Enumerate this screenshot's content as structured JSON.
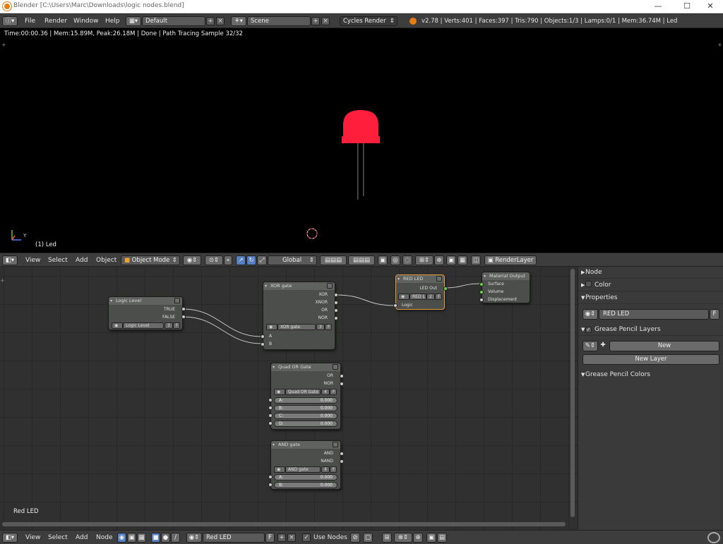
{
  "window": {
    "title": "Blender [C:\\Users\\Marc\\Downloads\\logic nodes.blend]",
    "minimize": "—",
    "maximize": "☐",
    "close": "✕"
  },
  "info_header": {
    "menus": [
      "File",
      "Render",
      "Window",
      "Help"
    ],
    "screen_layout": "Default",
    "scene": "Scene",
    "render_engine": "Cycles Render",
    "stats": "v2.78 | Verts:401 | Faces:397 | Tris:790 | Objects:1/3 | Lamps:0/1 | Mem:36.74M | Led"
  },
  "viewport": {
    "render_info": "Time:00:00.36 | Mem:15.89M, Peak:26.18M | Done | Path Tracing Sample 32/32",
    "object_label": "(1) Led",
    "axis_y": "Y"
  },
  "view3d_header": {
    "menus": [
      "View",
      "Select",
      "Add",
      "Object"
    ],
    "mode": "Object Mode",
    "orientation": "Global",
    "render_layer": "RenderLayer"
  },
  "node_editor": {
    "material_label": "Red LED",
    "nodes": {
      "logic_level": {
        "title": "Logic Level",
        "outputs": [
          "TRUE",
          "FALSE"
        ],
        "group": "Logic Level",
        "users": "3",
        "fake": "F"
      },
      "xor_gate": {
        "title": "XOR gate",
        "outputs": [
          "XOR",
          "XNOR",
          "OR",
          "NOR"
        ],
        "group": "XOR gate",
        "users": "3",
        "fake": "F",
        "inputs": [
          "A",
          "B"
        ]
      },
      "red_led": {
        "title": "RED LED",
        "output": "LED Out",
        "group": "RED L",
        "users": "2",
        "fake": "F",
        "input": "Logic"
      },
      "material_output": {
        "title": "Material Output",
        "inputs": [
          "Surface",
          "Volume",
          "Displacement"
        ]
      },
      "quad_or": {
        "title": "Quad OR Gate",
        "outputs": [
          "OR",
          "NOR"
        ],
        "group": "Quad OR Gate",
        "users": "4",
        "fake": "F",
        "inputs": [
          {
            "label": "A:",
            "value": "0.000"
          },
          {
            "label": "B:",
            "value": "0.000"
          },
          {
            "label": "C:",
            "value": "0.000"
          },
          {
            "label": "D:",
            "value": "0.000"
          }
        ]
      },
      "and_gate": {
        "title": "AND gate",
        "outputs": [
          "AND",
          "NAND"
        ],
        "group": "AND gate",
        "users": "4",
        "fake": "F",
        "inputs": [
          {
            "label": "A:",
            "value": "0.000"
          },
          {
            "label": "B:",
            "value": "0.000"
          }
        ]
      }
    }
  },
  "properties_panel": {
    "sections": {
      "node": "Node",
      "color": "Color",
      "properties": "Properties",
      "grease_layers": "Grease Pencil Layers",
      "grease_colors": "Grease Pencil Colors"
    },
    "node_group_name": "RED LED",
    "fake_user": "F",
    "new_label": "New",
    "new_layer_label": "New Layer"
  },
  "node_header": {
    "menus": [
      "View",
      "Select",
      "Add",
      "Node"
    ],
    "material": "Red LED",
    "fake_user": "F",
    "use_nodes": "Use Nodes"
  },
  "colors": {
    "led_red": "#ff1f3c",
    "selected_node_border": "#e59b3a",
    "socket_green": "#6fcf4a"
  }
}
